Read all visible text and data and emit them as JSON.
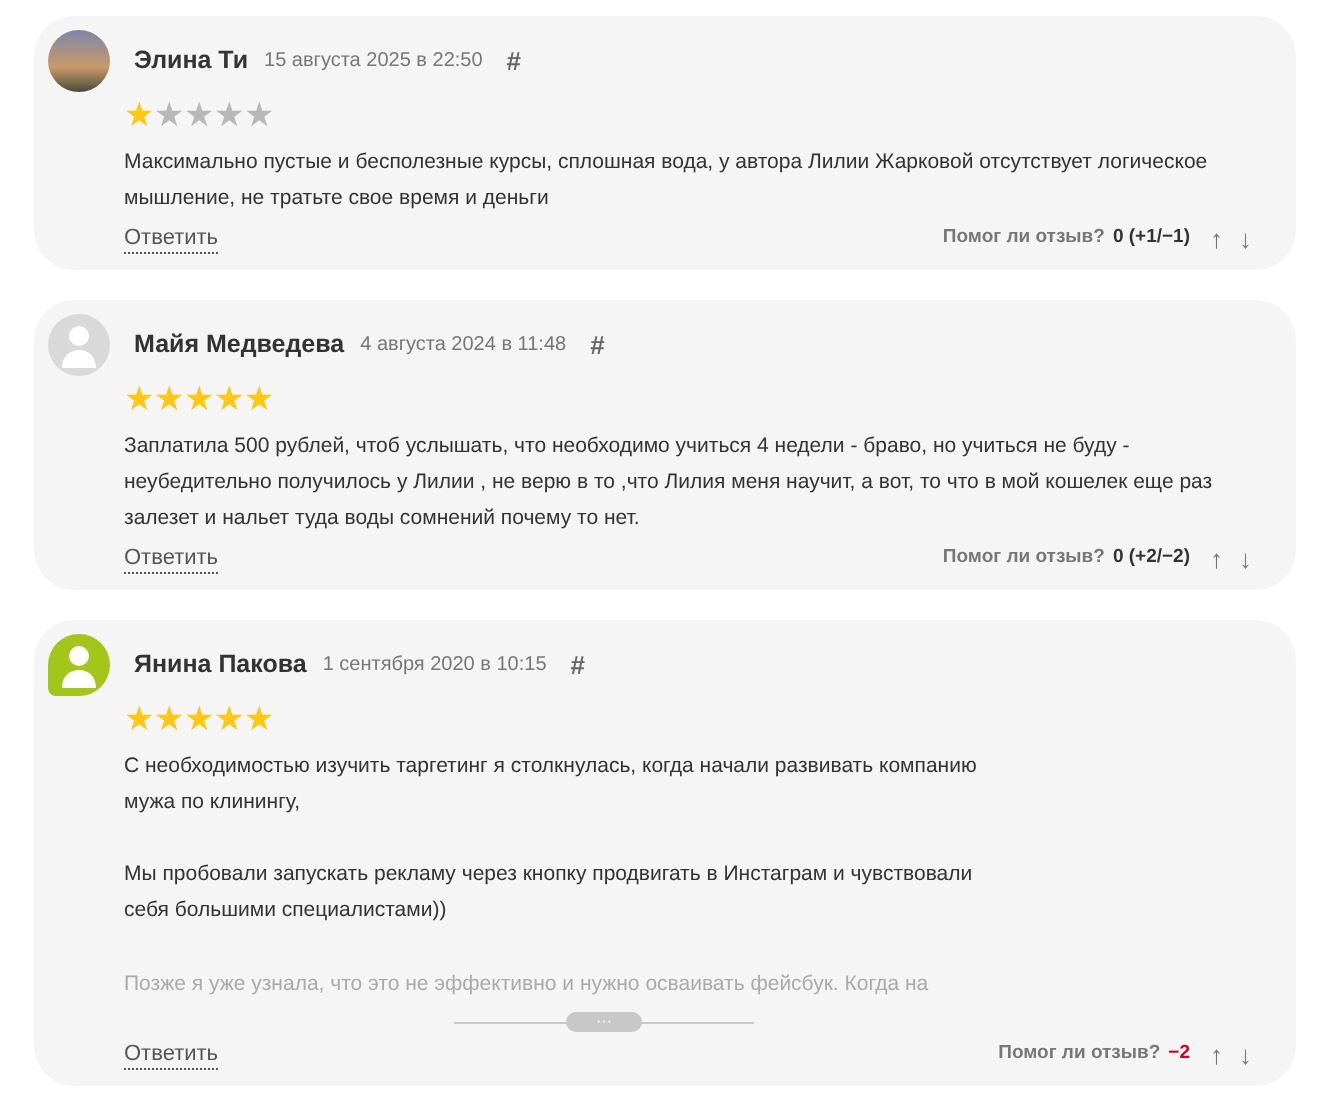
{
  "reviews": [
    {
      "avatar": {
        "kind": "photo"
      },
      "author": "Элина Ти",
      "date": "15 августа 2025 в 22:50",
      "anchor": "#",
      "stars": 1,
      "paragraphs": [
        "Максимально пустые и бесполезные курсы, сплошная вода, у автора Лилии Жарковой отсутствует логическое мышление, не тратьте свое время и деньги"
      ],
      "collapsed": false,
      "reply": "Ответить",
      "helpful_label": "Помог ли отзыв?",
      "score": "0 (+1/−1)",
      "score_negative": false,
      "up": "↑",
      "down": "↓"
    },
    {
      "avatar": {
        "kind": "silhouette"
      },
      "author": "Майя Медведева",
      "date": "4 августа 2024 в 11:48",
      "anchor": "#",
      "stars": 5,
      "paragraphs": [
        "Заплатила 500 рублей, чтоб услышать, что необходимо учиться 4 недели - браво, но учиться не буду - неубедительно получилось у Лилии , не верю в то ,что Лилия меня научит, а вот, то что в мой кошелек еще раз залезет и нальет туда воды сомнений почему то нет."
      ],
      "collapsed": false,
      "reply": "Ответить",
      "helpful_label": "Помог ли отзыв?",
      "score": "0 (+2/−2)",
      "score_negative": false,
      "up": "↑",
      "down": "↓"
    },
    {
      "avatar": {
        "kind": "green"
      },
      "author": "Янина Пакова",
      "date": "1 сентября 2020 в 10:15",
      "anchor": "#",
      "stars": 5,
      "paragraphs": [
        "С необходимостью изучить таргетинг я столкнулась, когда начали развивать компанию мужа по клинингу,",
        "Мы пробовали запускать рекламу через кнопку продвигать в Инстаграм и чувствовали себя большими специалистами))",
        "Позже я уже узнала, что это не эффективно и нужно осваивать фейсбук. Когда на"
      ],
      "collapsed": true,
      "expand": "···",
      "reply": "Ответить",
      "helpful_label": "Помог ли отзыв?",
      "score": "−2",
      "score_negative": true,
      "up": "↑",
      "down": "↓"
    }
  ]
}
